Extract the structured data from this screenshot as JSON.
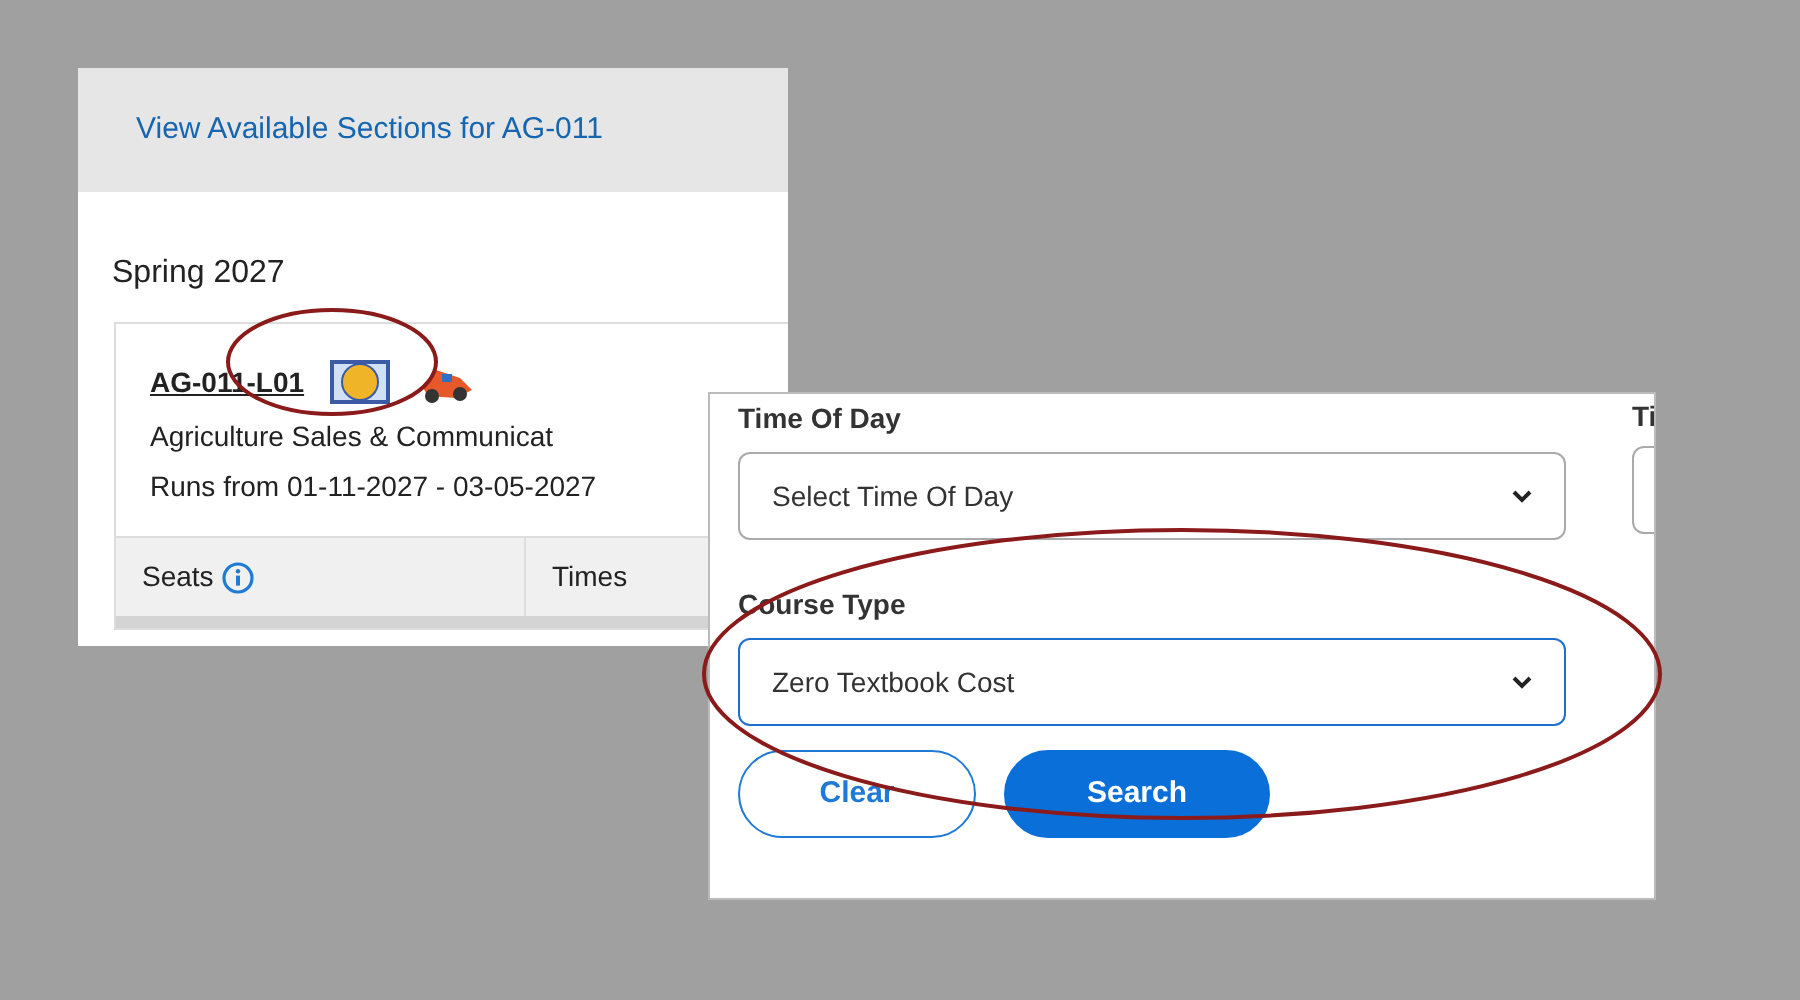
{
  "sections_panel": {
    "header_link": "View Available Sections for AG-011",
    "term": "Spring 2027",
    "section": {
      "code": "AG-011-L01",
      "title": "Agriculture Sales & Communicat",
      "runs": "Runs from 01-11-2027 - 03-05-2027"
    },
    "columns": [
      {
        "label": "Seats",
        "kind": "info"
      },
      {
        "label": "Times",
        "kind": "plain"
      }
    ]
  },
  "filter_panel": {
    "fields": [
      {
        "label": "Time Of Day",
        "value": "Select Time Of Day",
        "focused": false
      },
      {
        "label": "Course Type",
        "value": "Zero Textbook Cost",
        "focused": true
      }
    ],
    "side_label": "Ti",
    "buttons": [
      {
        "label": "Clear",
        "kind": "outline"
      },
      {
        "label": "Search",
        "kind": "primary"
      }
    ]
  }
}
